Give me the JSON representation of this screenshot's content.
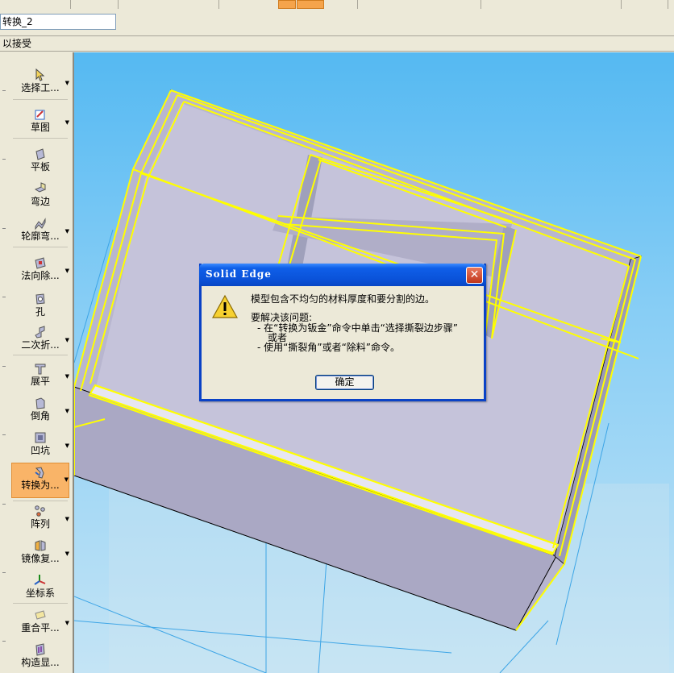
{
  "document": {
    "name_value": "转换_2"
  },
  "prompt": {
    "text": "以接受"
  },
  "ribbon": {
    "items": [
      {
        "label": "选择工..."
      },
      {
        "label": "草图"
      },
      {
        "label": "平板"
      },
      {
        "label": "弯边"
      },
      {
        "label": "轮廓弯..."
      },
      {
        "label": "法向除..."
      },
      {
        "label": "孔"
      },
      {
        "label": "二次折..."
      },
      {
        "label": "展平"
      },
      {
        "label": "倒角"
      },
      {
        "label": "凹坑"
      },
      {
        "label": "转换为..."
      },
      {
        "label": "阵列"
      },
      {
        "label": "镜像复..."
      },
      {
        "label": "坐标系"
      },
      {
        "label": "重合平..."
      },
      {
        "label": "构造显..."
      }
    ]
  },
  "dialog": {
    "title": "Solid Edge",
    "close_glyph": "✕",
    "message": "模型包含不均匀的材料厚度和要分割的边。",
    "resolve_heading": "要解决该问题:",
    "step1": "- 在“转换为钣金”命令中单击“选择撕裂边步骤”",
    "step1_cont": "或者",
    "step2": "- 使用“撕裂角”或者“除料”命令。",
    "ok_label": "确定"
  },
  "colors": {
    "viewport_top": "#55b9f2",
    "viewport_bottom": "#c4e4f5",
    "highlight_edge": "#ffff00",
    "titlebar_blue": "#0a52d9",
    "active_tool": "#f9b468"
  },
  "icons": [
    "select-arrow-icon",
    "sketch-icon",
    "plate-icon",
    "flange-icon",
    "contour-flange-icon",
    "normal-cutout-icon",
    "hole-icon",
    "jog-icon",
    "unbend-icon",
    "chamfer-icon",
    "dimple-icon",
    "convert-icon",
    "pattern-icon",
    "mirror-copy-icon",
    "coordinate-system-icon",
    "coincident-plane-icon",
    "construction-display-icon",
    "warning-icon",
    "close-icon"
  ]
}
